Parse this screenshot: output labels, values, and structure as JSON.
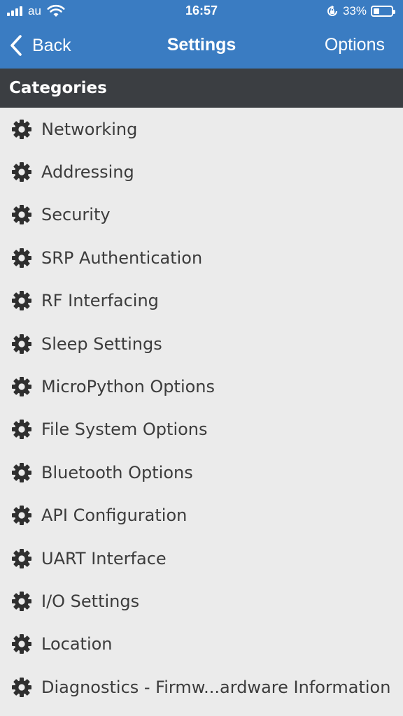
{
  "status_bar": {
    "carrier": "au",
    "time": "16:57",
    "battery_percent": "33%",
    "battery_level": 0.33
  },
  "nav": {
    "back_label": "Back",
    "title": "Settings",
    "options_label": "Options"
  },
  "section": {
    "title": "Categories"
  },
  "categories": [
    {
      "label": "Networking"
    },
    {
      "label": "Addressing"
    },
    {
      "label": "Security"
    },
    {
      "label": "SRP Authentication"
    },
    {
      "label": "RF Interfacing"
    },
    {
      "label": "Sleep Settings"
    },
    {
      "label": "MicroPython Options"
    },
    {
      "label": "File System Options"
    },
    {
      "label": "Bluetooth Options"
    },
    {
      "label": "API Configuration"
    },
    {
      "label": "UART Interface"
    },
    {
      "label": "I/O Settings"
    },
    {
      "label": "Location"
    },
    {
      "label": "Diagnostics - Firmw...ardware Information"
    }
  ],
  "icons": {
    "category_icon": "gear-icon",
    "back_icon": "chevron-left-icon"
  },
  "colors": {
    "header_bg": "#3a7cc2",
    "section_bg": "#3b3e42",
    "list_bg": "#ebebeb",
    "text": "#3c3c3c"
  }
}
